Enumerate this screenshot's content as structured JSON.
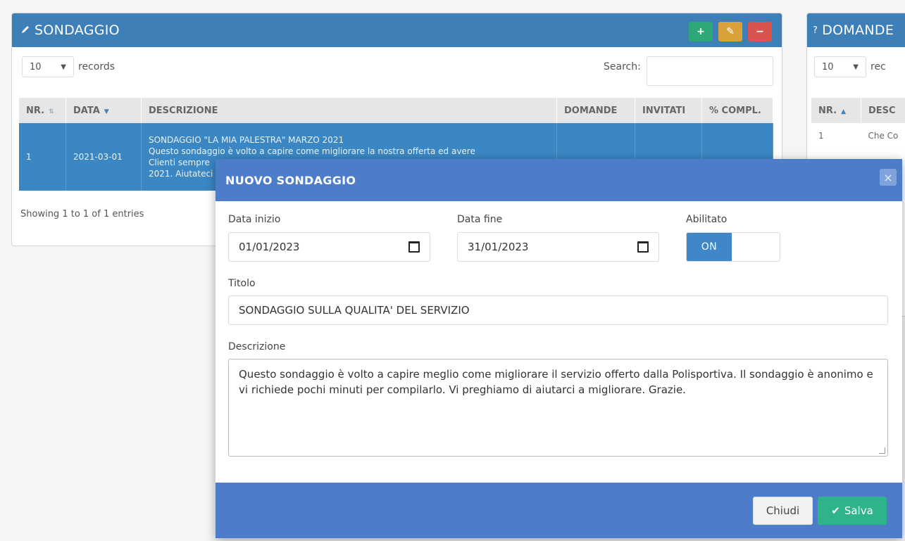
{
  "left_panel": {
    "title": "SONDAGGIO",
    "buttons": {
      "add": "+",
      "edit": "✎",
      "delete": "−"
    },
    "length_value": "10",
    "records_label": "records",
    "search_label": "Search:",
    "columns": [
      "NR.",
      "DATA",
      "DESCRIZIONE",
      "DOMANDE",
      "INVITATI",
      "% COMPL."
    ],
    "row": {
      "nr": "1",
      "data": "2021-03-01",
      "descrizione_lines": [
        "SONDAGGIO \"LA MIA PALESTRA\" MARZO 2021",
        "Questo sondaggio è volto a capire come migliorare la nostra offerta ed avere",
        "Clienti sempre",
        "2021. Aiutateci"
      ]
    },
    "footer": "Showing 1 to 1 of 1 entries"
  },
  "right_panel": {
    "title": "DOMANDE",
    "length_value": "10",
    "records_label": "rec",
    "columns": [
      "NR.",
      "DESC"
    ],
    "row": {
      "nr": "1",
      "desc": "Che Co"
    }
  },
  "modal": {
    "title": "NUOVO SONDAGGIO",
    "close_symbol": "×",
    "data_inizio_label": "Data inizio",
    "data_inizio_value": "01/01/2023",
    "data_fine_label": "Data fine",
    "data_fine_value": "31/01/2023",
    "abilitato_label": "Abilitato",
    "toggle_on": "ON",
    "titolo_label": "Titolo",
    "titolo_value": "SONDAGGIO SULLA QUALITA' DEL SERVIZIO",
    "descrizione_label": "Descrizione",
    "descrizione_value": "Questo sondaggio è volto a capire meglio come migliorare il servizio offerto dalla Polisportiva. Il sondaggio è anonimo e vi richiede pochi minuti per compilarlo. Vi preghiamo di aiutarci a migliorare. Grazie.",
    "chiudi_label": "Chiudi",
    "salva_label": "Salva"
  },
  "colors": {
    "primary": "#3f7fb8",
    "modal_header": "#4d7cc9",
    "success": "#2fb38b",
    "warning": "#d9a13a",
    "danger": "#d9534f"
  }
}
